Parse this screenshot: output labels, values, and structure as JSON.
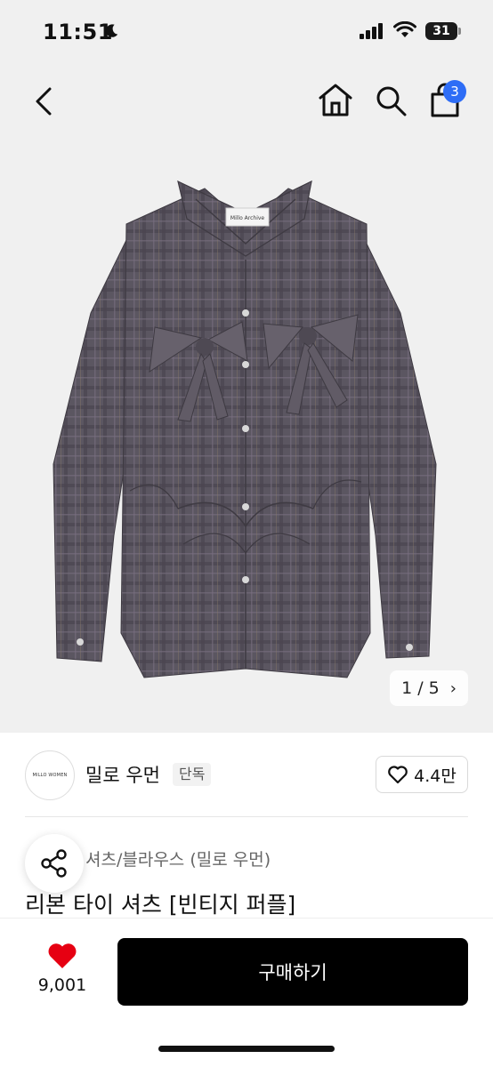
{
  "status_bar": {
    "time": "11:51",
    "battery": "31"
  },
  "header": {
    "cart_count": "3"
  },
  "gallery": {
    "current": "1",
    "separator": "/",
    "total": "5",
    "label_tag": "Millo Archive"
  },
  "brand": {
    "logo_text": "MILLO WOMEN",
    "name": "밀로 우먼",
    "badge": "단독",
    "likes": "4.4만"
  },
  "product": {
    "category": "셔츠/블라우스 (밀로 우먼)",
    "title": "리본 타이 셔츠 [빈티지 퍼플]"
  },
  "bottom_bar": {
    "wish_count": "9,001",
    "buy_label": "구매하기"
  },
  "colors": {
    "accent_badge": "#2e6df6",
    "heart": "#e60012",
    "buy_button": "#000000",
    "shirt": "#5a5560"
  }
}
